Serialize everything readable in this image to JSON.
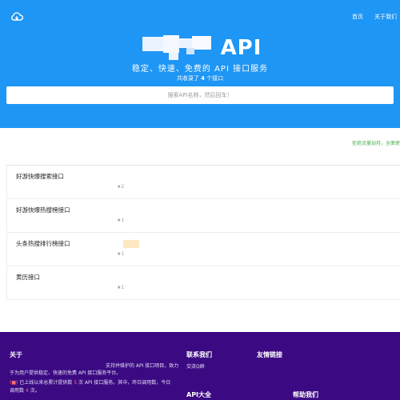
{
  "header": {
    "logo_icon": "cloud-icon",
    "nav": [
      "首页",
      "关于我们"
    ],
    "brand_text": "API",
    "slogan": "稳定、快速、免费的 API 接口服务",
    "count_prefix": "共收录了 ",
    "count_value": "4",
    "count_suffix": " 个接口"
  },
  "search": {
    "placeholder": "搜索API名称，然后回车！"
  },
  "marquee": "拒绝流量劫持，全面使",
  "apis": [
    {
      "name": "好游快爆搜索接口",
      "stars": "★2"
    },
    {
      "name": "好游快爆热搜榜接口",
      "stars": "★1"
    },
    {
      "name": "头条热搜排行榜接口",
      "stars": "★1"
    },
    {
      "name": "黄历接口",
      "stars": "★1"
    }
  ],
  "footer": {
    "about_title": "关于",
    "about_line1": "支持并维护的 API 接口项目，致力",
    "about_line2": "于为用户提供稳定、快速的免费 API 接口服务平台。",
    "stats_a": "已上线以来总累计提供数",
    "stats_total": "5",
    "stats_b": "次 API 接口服务。其中，昨日调用数",
    "stats_c": "，今日调用数",
    "stats_today": "4",
    "stats_d": "次。",
    "contact_title": "联系我们",
    "contact_link": "交流Q群",
    "friends_title": "友情链接",
    "apis_title": "API大全",
    "help_title": "帮助我们"
  },
  "colors": {
    "hero": "#1e96f5",
    "footer": "#3b0a82",
    "marquee": "#4caf50"
  }
}
